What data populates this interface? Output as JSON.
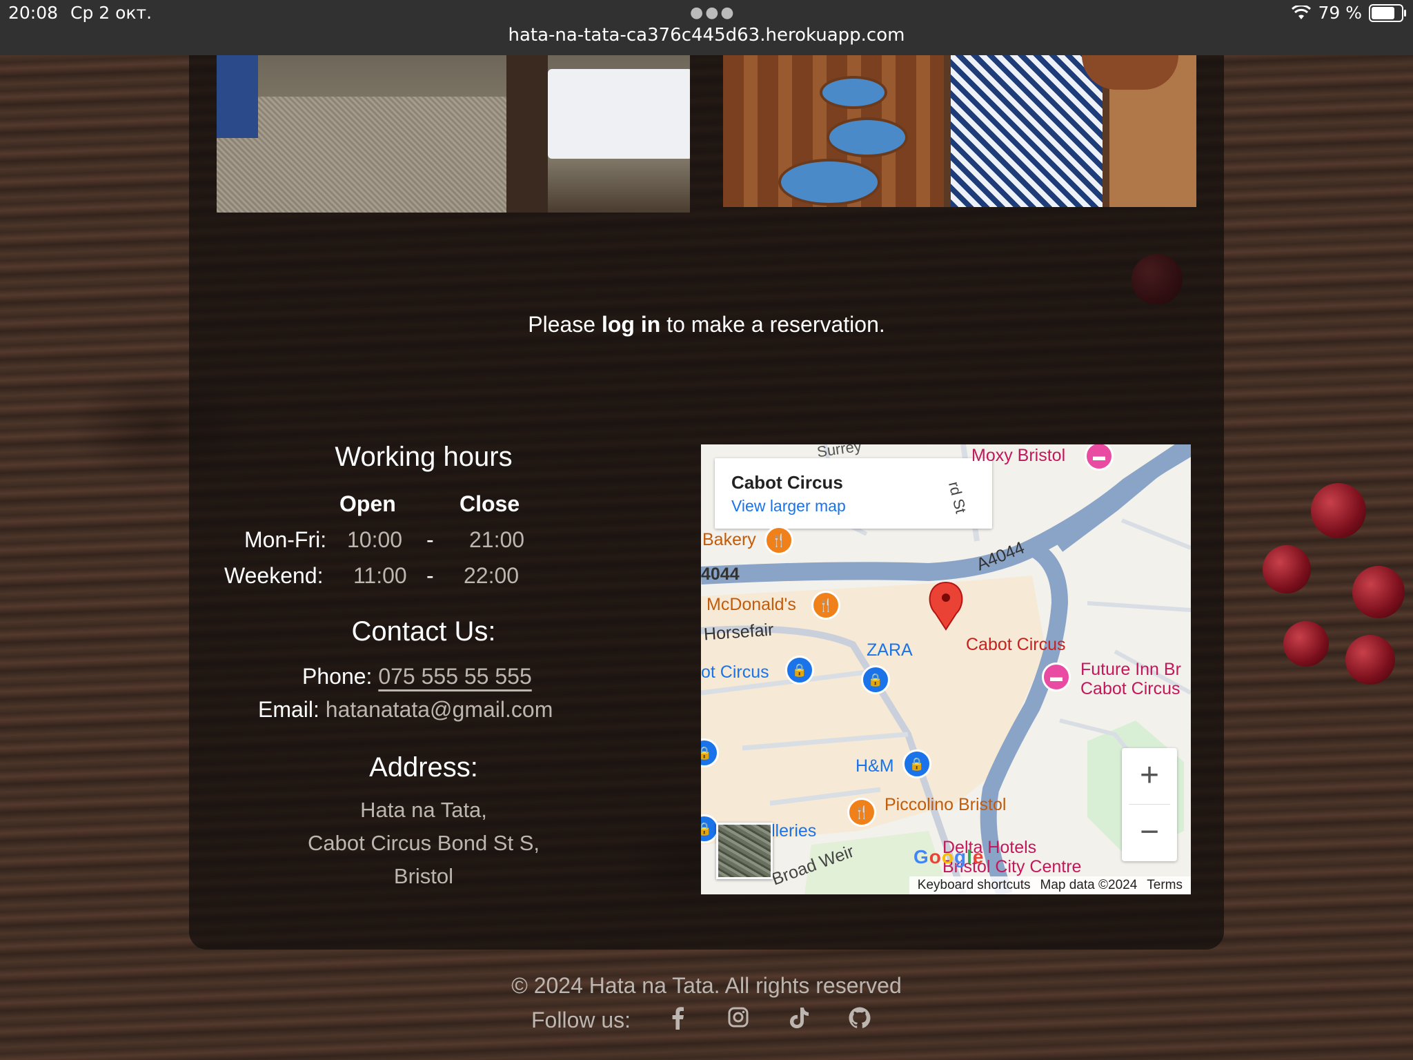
{
  "status_bar": {
    "time": "20:08",
    "date": "Ср 2 окт.",
    "url": "hata-na-tata-ca376c445d63.herokuapp.com",
    "battery": "79 %",
    "battery_level": 0.79
  },
  "reservation": {
    "prefix": "Please ",
    "link": "log in",
    "suffix": " to make a reservation."
  },
  "hours": {
    "title": "Working hours",
    "open_label": "Open",
    "close_label": "Close",
    "rows": [
      {
        "day": "Mon-Fri:",
        "open": "10:00",
        "sep": "-",
        "close": "21:00"
      },
      {
        "day": "Weekend:",
        "open": "11:00",
        "sep": "-",
        "close": "22:00"
      }
    ]
  },
  "contact": {
    "title": "Contact Us:",
    "phone_label": "Phone:",
    "phone": "075 555 55 555",
    "email_label": "Email:",
    "email": "hatanatata@gmail.com"
  },
  "address": {
    "title": "Address:",
    "lines": [
      "Hata na Tata,",
      "Cabot Circus Bond St S,",
      "Bristol"
    ]
  },
  "map": {
    "card_title": "Cabot Circus",
    "card_link": "View larger map",
    "labels": {
      "moxy": "Moxy Bristol",
      "surrey": "Surrey",
      "bakery": "Bakery",
      "a4044_left": "4044",
      "a4044_right": "A4044",
      "mcdonalds": "McDonald's",
      "horsefair": "Horsefair",
      "zara": "ZARA",
      "cabot_circus": "Cabot Circus",
      "cabot_circus_left": "ot Circus",
      "future_inn_1": "Future Inn Br",
      "future_inn_2": "Cabot Circus",
      "hm": "H&M",
      "piccolino": "Piccolino Bristol",
      "galleries": "lleries",
      "broad_weir": "Broad Weir",
      "delta_1": "Delta Hotels",
      "delta_2": "Bristol City Centre",
      "bond_st": "rd St",
      "google": "Google"
    },
    "zoom_in": "+",
    "zoom_out": "−",
    "attribution": {
      "shortcuts": "Keyboard shortcuts",
      "data": "Map data ©2024",
      "terms": "Terms"
    }
  },
  "footer": {
    "copyright": "© 2024 Hata na Tata. All rights reserved",
    "follow_label": "Follow us:",
    "socials": [
      "facebook-icon",
      "instagram-icon",
      "tiktok-icon",
      "github-icon"
    ]
  }
}
